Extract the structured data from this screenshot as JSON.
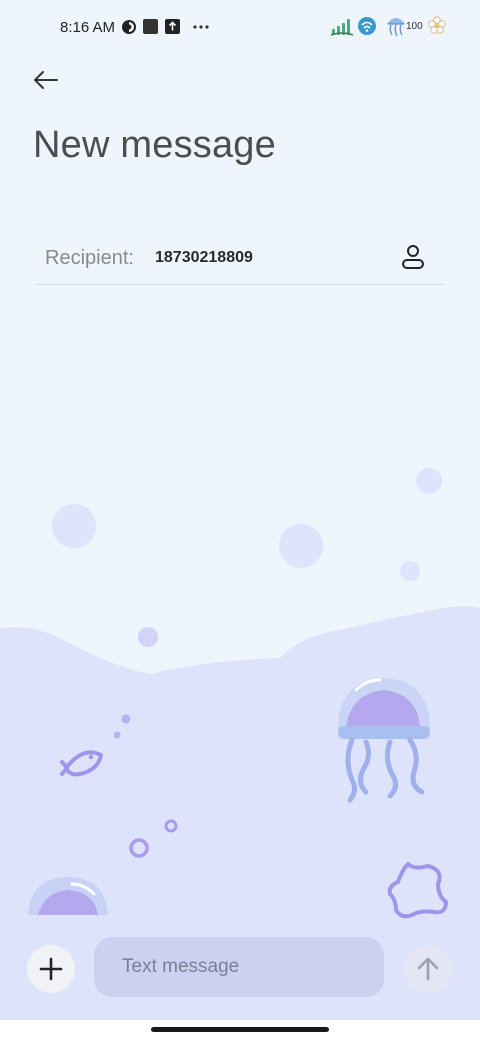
{
  "status_bar": {
    "time": "8:16 AM",
    "battery": "100",
    "left_icons": [
      "vpn-icon",
      "square-app-icon",
      "upload-icon",
      "more-dots-icon"
    ],
    "right_icons": [
      "signal-icon",
      "wifi-icon",
      "jellyfish-theme-icon",
      "flower-icon"
    ]
  },
  "header": {
    "back_icon": "arrow-left-icon",
    "title": "New message"
  },
  "recipient": {
    "label": "Recipient:",
    "value": "18730218809",
    "contact_icon": "person-icon"
  },
  "composer": {
    "attach_icon": "plus-icon",
    "placeholder": "Text message",
    "send_icon": "arrow-up-icon"
  },
  "colors": {
    "background": "#eef5fd",
    "wave": "#dde3fb",
    "accent_purple": "#a99cf0",
    "input_bg": "#cbd2f0"
  }
}
